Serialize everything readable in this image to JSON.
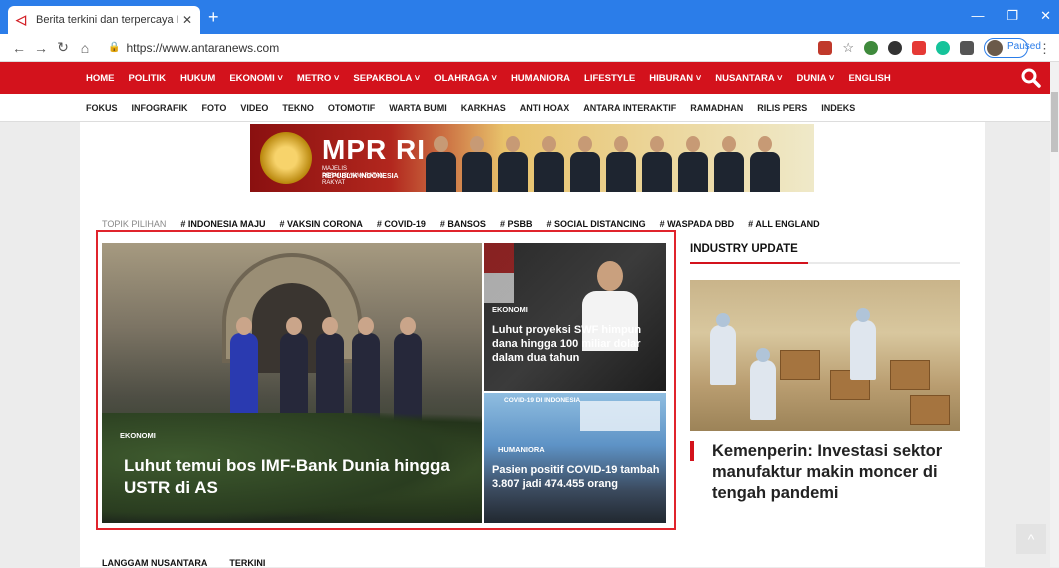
{
  "browser": {
    "tab_title": "Berita terkini dan terpercaya Indo",
    "tab_close": "✕",
    "new_tab": "+",
    "url": "https://www.antaranews.com",
    "profile_status": "Paused",
    "window_controls": [
      "—",
      "❐",
      "✕"
    ]
  },
  "main_nav": {
    "items": [
      "HOME",
      "POLITIK",
      "HUKUM",
      "EKONOMI ˅",
      "METRO ˅",
      "SEPAKBOLA ˅",
      "OLAHRAGA ˅",
      "HUMANIORA",
      "LIFESTYLE",
      "HIBURAN ˅",
      "NUSANTARA ˅",
      "DUNIA ˅",
      "ENGLISH"
    ],
    "color": "#d3121c"
  },
  "sub_nav": {
    "items": [
      "FOKUS",
      "INFOGRAFIK",
      "FOTO",
      "VIDEO",
      "TEKNO",
      "OTOMOTIF",
      "WARTA BUMI",
      "KARKHAS",
      "ANTI HOAX",
      "ANTARA INTERAKTIF",
      "RAMADHAN",
      "RILIS PERS",
      "INDEKS"
    ]
  },
  "banner": {
    "title": "MPR RI",
    "subtitle": "MAJELIS PERMUSYAWARATAN RAKYAT",
    "subtitle2": "REPUBLIK INDONESIA"
  },
  "topik": {
    "label": "TOPIK PILIHAN",
    "tags": [
      "# INDONESIA MAJU",
      "# VAKSIN CORONA",
      "# COVID-19",
      "# BANSOS",
      "# PSBB",
      "# SOCIAL DISTANCING",
      "# WASPADA DBD",
      "# ALL ENGLAND"
    ]
  },
  "feature_main": {
    "category": "EKONOMI",
    "headline": "Luhut temui bos IMF-Bank Dunia hingga USTR di AS"
  },
  "feature_side1": {
    "category": "EKONOMI",
    "headline": "Luhut proyeksi SWF himpun dana hingga 100 miliar dolar dalam dua tahun"
  },
  "feature_side2": {
    "category": "HUMANIORA",
    "headline": "Pasien positif COVID-19 tambah 3.807 jadi 474.455 orang",
    "image_text": "COVID-19 DI INDONESIA"
  },
  "industry": {
    "heading": "INDUSTRY UPDATE",
    "headline": "Kemenperin: Investasi sektor manufaktur makin moncer di tengah pandemi"
  },
  "bottom_tabs": [
    "LANGGAM NUSANTARA",
    "TERKINI"
  ],
  "scroll_top": "^"
}
